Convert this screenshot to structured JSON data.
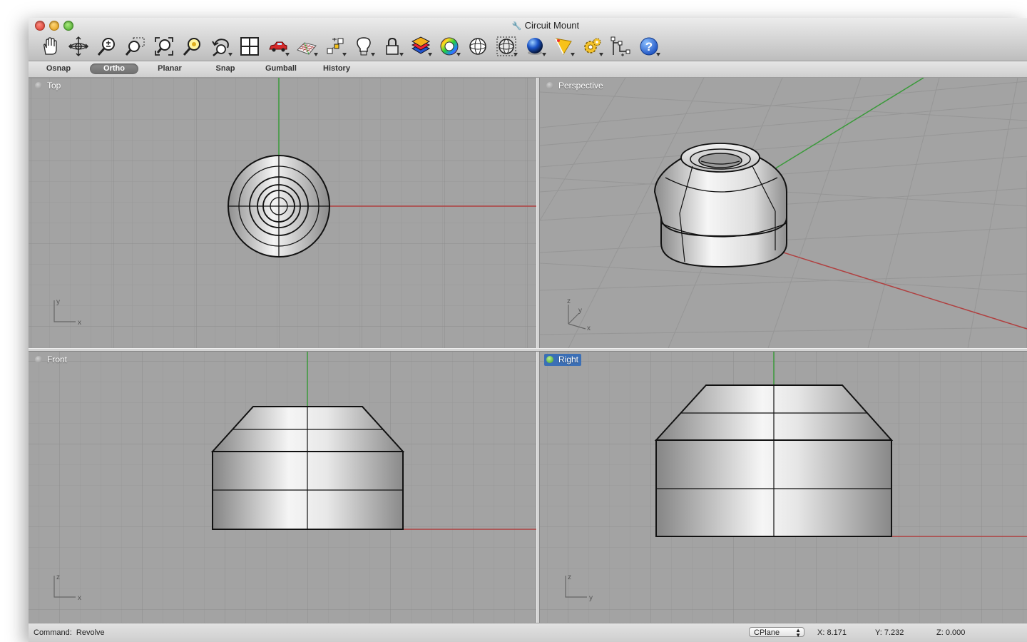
{
  "window": {
    "title": "Circuit Mount"
  },
  "toolbar": {
    "icons": [
      "pan-hand-icon",
      "rotate-view-icon",
      "zoom-in-out-icon",
      "zoom-window-icon",
      "zoom-extents-icon",
      "zoom-selected-icon",
      "undo-view-icon",
      "viewport-layout-icon",
      "car-named-views-icon",
      "cplane-grid-icon",
      "gumball-icon",
      "light-bulb-icon",
      "lock-icon",
      "layers-icon",
      "color-wheel-icon",
      "wireframe-sphere-icon",
      "shaded-sphere-icon",
      "rendered-sphere-icon",
      "render-icon",
      "settings-gear-icon",
      "snap-points-icon",
      "help-icon"
    ]
  },
  "modes": [
    {
      "label": "Osnap",
      "active": false
    },
    {
      "label": "Ortho",
      "active": true
    },
    {
      "label": "Planar",
      "active": false
    },
    {
      "label": "Snap",
      "active": false
    },
    {
      "label": "Gumball",
      "active": false
    },
    {
      "label": "History",
      "active": false
    }
  ],
  "viewports": {
    "top": {
      "label": "Top",
      "axis_a": "y",
      "axis_b": "x"
    },
    "perspective": {
      "label": "Perspective",
      "axis_a": "z",
      "axis_b": "y",
      "axis_c": "x"
    },
    "front": {
      "label": "Front",
      "axis_a": "z",
      "axis_b": "x"
    },
    "right": {
      "label": "Right",
      "axis_a": "z",
      "axis_b": "y",
      "active": true
    }
  },
  "colors": {
    "grid_bg": "#a3a3a3",
    "grid_line": "#989898",
    "x_axis": "#b04040",
    "y_axis": "#3a9a3a",
    "active_label": "#3b6fb6"
  },
  "status": {
    "command_label": "Command:",
    "command_value": "Revolve",
    "cplane": "CPlane",
    "x": "X: 8.171",
    "y": "Y: 7.232",
    "z": "Z: 0.000"
  }
}
